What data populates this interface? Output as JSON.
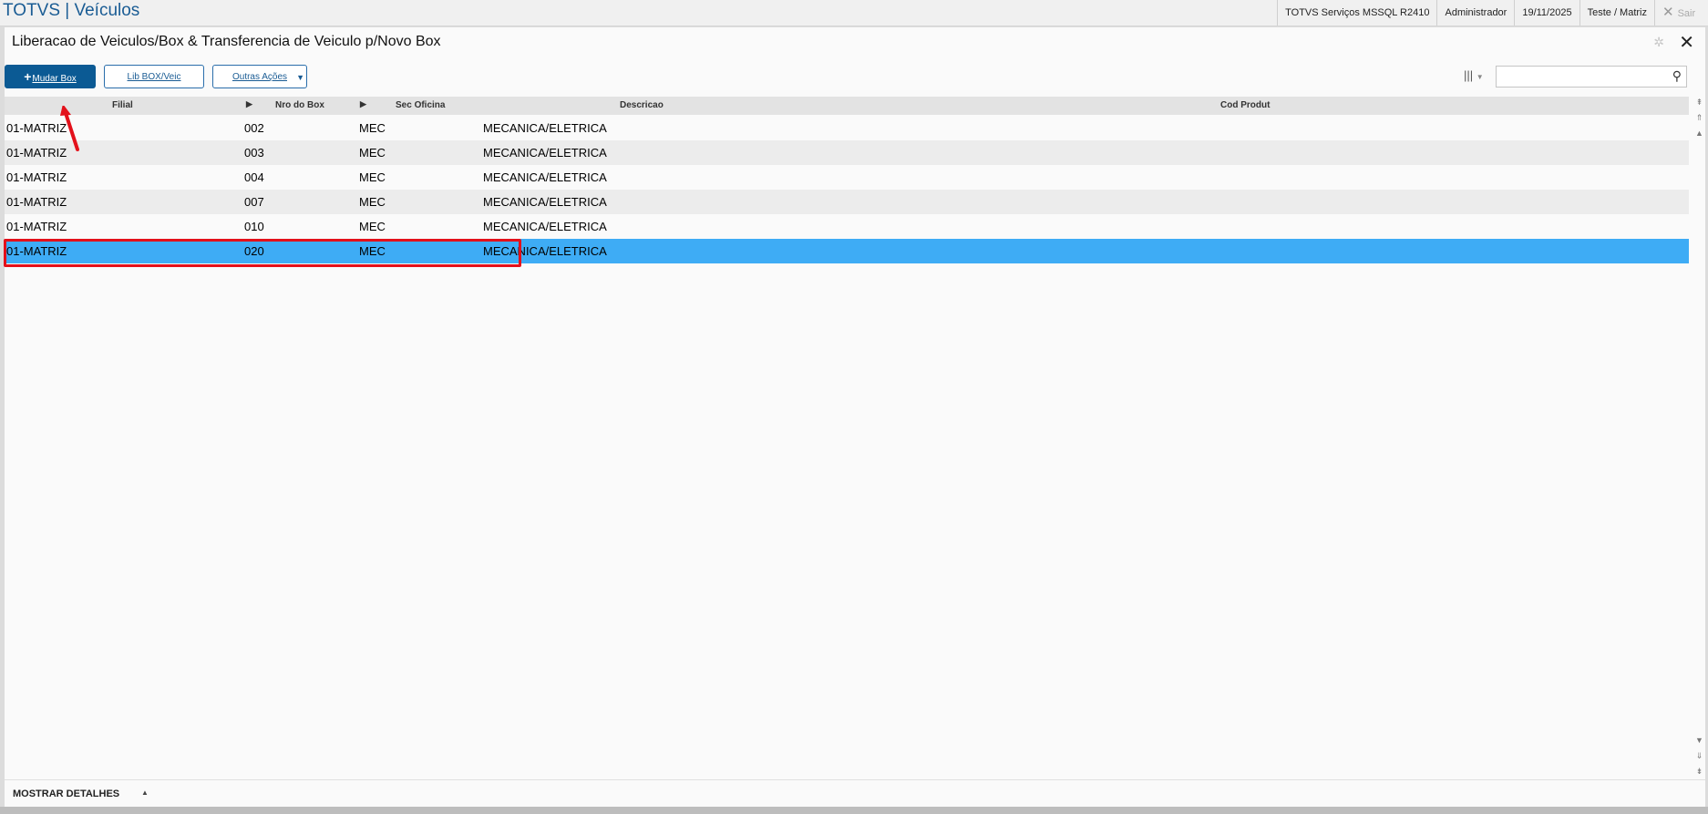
{
  "app": {
    "title": "TOTVS | Veículos"
  },
  "topbar": {
    "server": "TOTVS Serviços MSSQL R2410",
    "user": "Administrador",
    "date": "19/11/2025",
    "company": "Teste / Matriz",
    "exit_label": "Sair"
  },
  "page": {
    "title": "Liberacao de Veiculos/Box & Transferencia de Veiculo p/Novo Box"
  },
  "toolbar": {
    "primary_label": "Mudar Box",
    "lib_label": "Lib BOX/Veic",
    "outras_label": "Outras Ações",
    "search_placeholder": ""
  },
  "table": {
    "columns": [
      "Filial",
      "Nro do Box",
      "Sec Oficina",
      "Descricao",
      "Cod Produt"
    ],
    "rows": [
      [
        "01-MATRIZ",
        "002",
        "MEC",
        "MECANICA/ELETRICA",
        ""
      ],
      [
        "01-MATRIZ",
        "003",
        "MEC",
        "MECANICA/ELETRICA",
        ""
      ],
      [
        "01-MATRIZ",
        "004",
        "MEC",
        "MECANICA/ELETRICA",
        ""
      ],
      [
        "01-MATRIZ",
        "007",
        "MEC",
        "MECANICA/ELETRICA",
        ""
      ],
      [
        "01-MATRIZ",
        "010",
        "MEC",
        "MECANICA/ELETRICA",
        ""
      ],
      [
        "01-MATRIZ",
        "020",
        "MEC",
        "MECANICA/ELETRICA",
        ""
      ]
    ],
    "selected_row": 5
  },
  "footer": {
    "details_label": "MOSTRAR DETALHES"
  },
  "colors": {
    "brand": "#0b5a94",
    "selected_row": "#3eacf5",
    "annotation": "#e3111b"
  },
  "icons": [
    "gear-icon",
    "close-icon",
    "columns-icon",
    "search-icon",
    "plus-icon",
    "chevron-down-icon",
    "sort-arrow-icon",
    "scroll-up-icon",
    "scroll-down-icon",
    "expand-icon"
  ]
}
